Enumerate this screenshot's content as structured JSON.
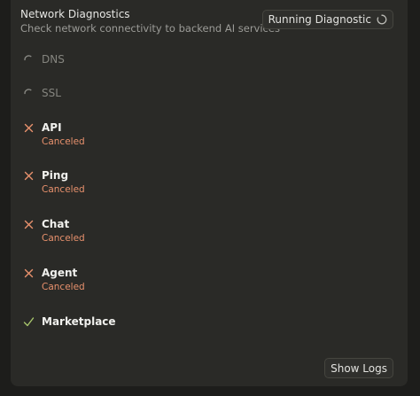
{
  "header": {
    "title": "Network Diagnostics",
    "subtitle": "Check network connectivity to backend AI services",
    "run_button_label": "Running Diagnostic"
  },
  "checks": [
    {
      "label": "DNS",
      "state": "pending",
      "status": ""
    },
    {
      "label": "SSL",
      "state": "pending",
      "status": ""
    },
    {
      "label": "API",
      "state": "canceled",
      "status": "Canceled"
    },
    {
      "label": "Ping",
      "state": "canceled",
      "status": "Canceled"
    },
    {
      "label": "Chat",
      "state": "canceled",
      "status": "Canceled"
    },
    {
      "label": "Agent",
      "state": "canceled",
      "status": "Canceled"
    },
    {
      "label": "Marketplace",
      "state": "success",
      "status": ""
    }
  ],
  "footer": {
    "show_logs_label": "Show Logs"
  },
  "colors": {
    "canceled": "#e8916d",
    "success": "#a8c66c",
    "pending": "#85857f"
  },
  "icons": {
    "pending": "spinner-icon",
    "canceled": "x-icon",
    "success": "check-icon"
  }
}
